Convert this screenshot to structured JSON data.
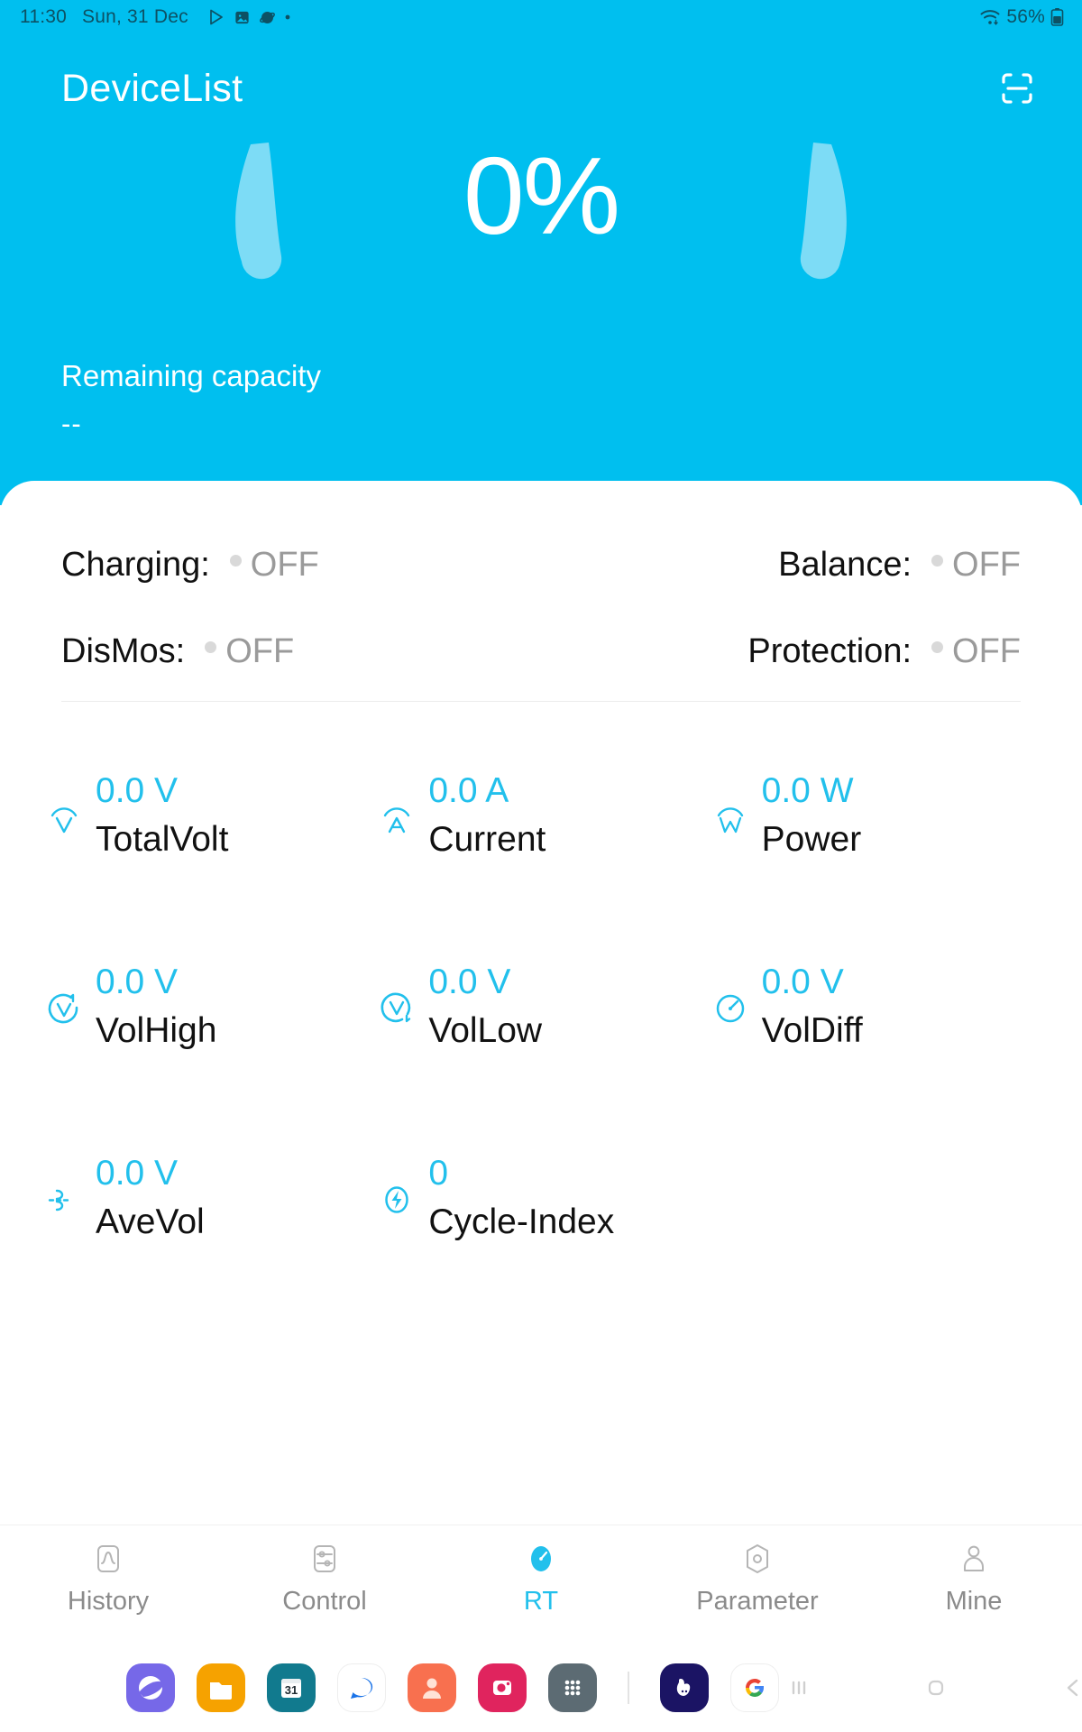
{
  "statusbar": {
    "time": "11:30",
    "date": "Sun, 31 Dec",
    "icons": [
      "play-store-icon",
      "gallery-icon",
      "samsung-internet-icon",
      "dot-icon"
    ],
    "wifi_icon": "wifi-icon",
    "battery_pct": "56%",
    "battery_icon": "battery-icon"
  },
  "header": {
    "title": "DeviceList",
    "scan_icon": "scan-qr-icon",
    "gauge_percent": "0%",
    "remaining_label": "Remaining capacity",
    "remaining_value": "--",
    "accent": "#00BFEF"
  },
  "status": {
    "rows": [
      {
        "left": {
          "label": "Charging:",
          "value": "OFF",
          "state": "off"
        },
        "right": {
          "label": "Balance:",
          "value": "OFF",
          "state": "off"
        }
      },
      {
        "left": {
          "label": "DisMos:",
          "value": "OFF",
          "state": "off"
        },
        "right": {
          "label": "Protection:",
          "value": "OFF",
          "state": "off"
        }
      }
    ]
  },
  "metrics": [
    [
      {
        "icon": "volt-arc-icon",
        "value": "0.0 V",
        "label": "TotalVolt"
      },
      {
        "icon": "ampere-arc-icon",
        "value": "0.0 A",
        "label": "Current"
      },
      {
        "icon": "watt-arc-icon",
        "value": "0.0 W",
        "label": "Power"
      }
    ],
    [
      {
        "icon": "volt-high-icon",
        "value": "0.0 V",
        "label": "VolHigh"
      },
      {
        "icon": "volt-low-icon",
        "value": "0.0 V",
        "label": "VolLow"
      },
      {
        "icon": "gauge-dial-icon",
        "value": "0.0 V",
        "label": "VolDiff"
      }
    ],
    [
      {
        "icon": "waveform-dc-icon",
        "value": "0.0 V",
        "label": "AveVol"
      },
      {
        "icon": "bolt-circle-icon",
        "value": "0",
        "label": "Cycle-Index"
      },
      {
        "icon": "",
        "value": "",
        "label": ""
      }
    ]
  ],
  "tabbar": {
    "active_color": "#22c0ec",
    "tabs": [
      {
        "label": "History",
        "icon": "chart-line-icon",
        "active": false
      },
      {
        "label": "Control",
        "icon": "sliders-icon",
        "active": false
      },
      {
        "label": "RT",
        "icon": "speedometer-icon",
        "active": true
      },
      {
        "label": "Parameter",
        "icon": "hex-gear-icon",
        "active": false
      },
      {
        "label": "Mine",
        "icon": "person-icon",
        "active": false
      }
    ]
  },
  "dock": {
    "apps": [
      {
        "name": "samsung-internet-icon",
        "color": "#7668e8"
      },
      {
        "name": "my-files-icon",
        "color": "#f6a200"
      },
      {
        "name": "calendar-icon",
        "color": "#117a8e",
        "badge": "31"
      },
      {
        "name": "messages-icon",
        "color": "#ffffff"
      },
      {
        "name": "contacts-icon",
        "color": "#f8704f"
      },
      {
        "name": "instagram-icon",
        "color": "#e0245e"
      },
      {
        "name": "apps-grid-icon",
        "color": "#5c6b73"
      }
    ],
    "apps2": [
      {
        "name": "lottery-icon",
        "color": "#1b1464"
      },
      {
        "name": "google-icon",
        "color": "#ffffff"
      }
    ],
    "nav": [
      {
        "name": "recents-button",
        "icon": "recents-icon"
      },
      {
        "name": "home-button",
        "icon": "home-icon"
      },
      {
        "name": "back-button",
        "icon": "back-icon"
      }
    ]
  }
}
